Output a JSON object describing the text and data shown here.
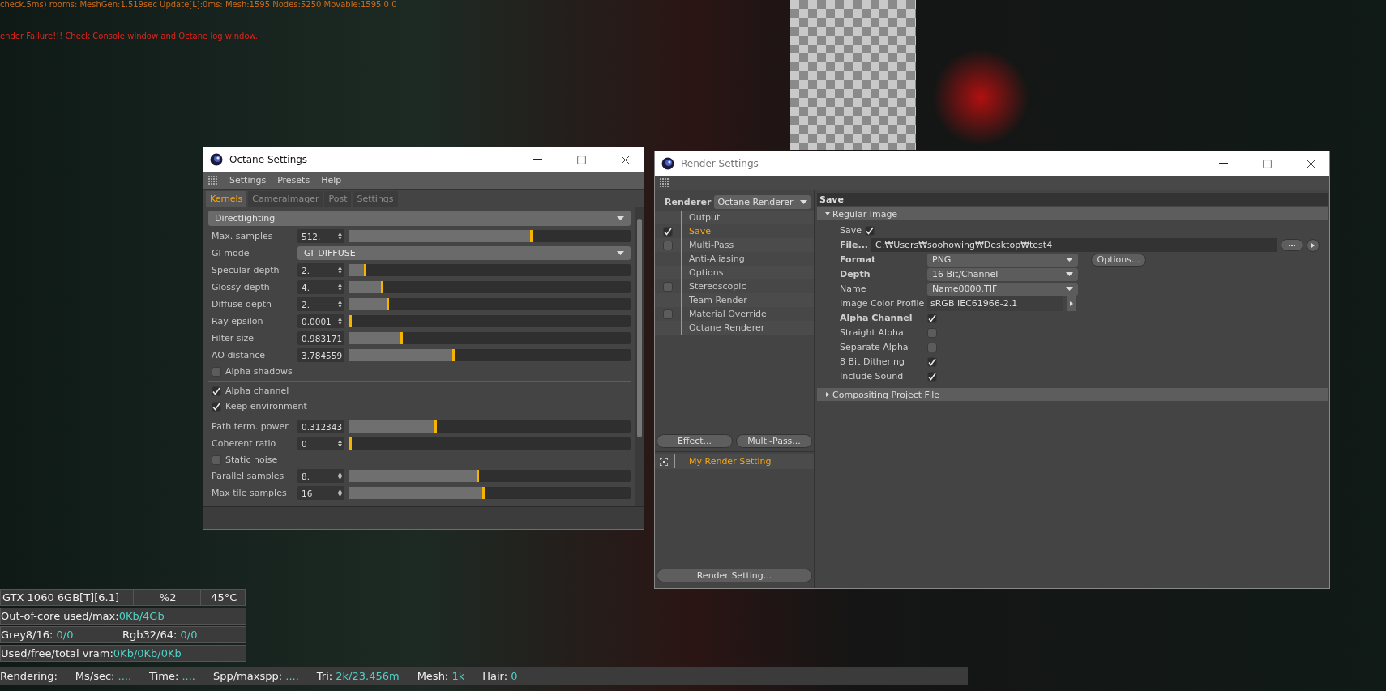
{
  "console_lines": [
    {
      "kind": "info",
      "text": "check.5ms) rooms: MeshGen:1.519sec Update[L]:0ms: Mesh:1595 Nodes:5250 Movable:1595  0 0"
    },
    {
      "kind": "error",
      "text": "ender Failure!!! Check Console window and Octane log window."
    }
  ],
  "octane_settings": {
    "title": "Octane Settings",
    "menu": [
      "Settings",
      "Presets",
      "Help"
    ],
    "tabs": [
      {
        "label": "Kernels",
        "selected": true
      },
      {
        "label": "CameraImager",
        "selected": false
      },
      {
        "label": "Post",
        "selected": false
      },
      {
        "label": "Settings",
        "selected": false
      }
    ],
    "kernel": "Directlighting",
    "rows": [
      {
        "kind": "slider",
        "label": "Max. samples",
        "value": "512.",
        "level": 0.65
      },
      {
        "kind": "dropdown",
        "label": "GI mode",
        "value": "GI_DIFFUSE"
      },
      {
        "kind": "slider",
        "label": "Specular depth",
        "value": "2.",
        "level": 0.06
      },
      {
        "kind": "slider",
        "label": "Glossy depth",
        "value": "4.",
        "level": 0.12
      },
      {
        "kind": "slider",
        "label": "Diffuse depth",
        "value": "2.",
        "level": 0.14
      },
      {
        "kind": "slider",
        "label": "Ray epsilon",
        "value": "0.0001",
        "level": 0
      },
      {
        "kind": "slider",
        "label": "Filter size",
        "value": "0.983171",
        "level": 0.19
      },
      {
        "kind": "slider",
        "label": "AO distance",
        "value": "3.784559",
        "level": 0.375
      },
      {
        "kind": "checkbox",
        "label": "Alpha shadows",
        "checked": false
      },
      {
        "kind": "divider"
      },
      {
        "kind": "checkbox",
        "label": "Alpha channel",
        "checked": true
      },
      {
        "kind": "checkbox",
        "label": "Keep environment",
        "checked": true
      },
      {
        "kind": "divider"
      },
      {
        "kind": "slider",
        "label": "Path term. power",
        "value": "0.312343",
        "level": 0.31
      },
      {
        "kind": "slider",
        "label": "Coherent ratio",
        "value": "0",
        "level": 0
      },
      {
        "kind": "checkbox",
        "label": "Static noise",
        "checked": false
      },
      {
        "kind": "slider",
        "label": "Parallel samples",
        "value": "8.",
        "level": 0.46
      },
      {
        "kind": "slider",
        "label": "Max tile samples",
        "value": "16",
        "level": 0.48
      }
    ]
  },
  "render_settings": {
    "title": "Render Settings",
    "renderer_label": "Renderer",
    "renderer": "Octane Renderer",
    "tree": [
      {
        "kind": "plain",
        "label": "Output",
        "selected": false
      },
      {
        "kind": "toggle",
        "label": "Save",
        "checked": true,
        "selected": true
      },
      {
        "kind": "toggle",
        "label": "Multi-Pass",
        "checked": false,
        "selected": false
      },
      {
        "kind": "plain",
        "label": "Anti-Aliasing",
        "selected": false
      },
      {
        "kind": "plain",
        "label": "Options",
        "selected": false
      },
      {
        "kind": "toggle",
        "label": "Stereoscopic",
        "checked": false,
        "selected": false
      },
      {
        "kind": "plain",
        "label": "Team Render",
        "selected": false
      },
      {
        "kind": "toggle",
        "label": "Material Override",
        "checked": false,
        "selected": false
      },
      {
        "kind": "plain",
        "label": "Octane Renderer",
        "selected": false
      }
    ],
    "buttons": [
      "Effect...",
      "Multi-Pass..."
    ],
    "setting_list": [
      {
        "label": "My Render Setting",
        "selected": true
      }
    ],
    "bottom_button": "Render Setting...",
    "panel_title": "Save",
    "sections": [
      {
        "title": "Regular Image",
        "expanded": true,
        "fields": [
          {
            "kind": "check",
            "label": "Save",
            "checked": true,
            "bold": false
          },
          {
            "kind": "file",
            "label": "File...",
            "value": "C:₩Users₩soohowing₩Desktop₩test4",
            "bold": true
          },
          {
            "kind": "select",
            "label": "Format",
            "value": "PNG",
            "button": "Options...",
            "bold": true
          },
          {
            "kind": "select",
            "label": "Depth",
            "value": "16 Bit/Channel",
            "bold": true
          },
          {
            "kind": "select",
            "label": "Name",
            "value": "Name0000.TIF",
            "bold": false
          },
          {
            "kind": "profile",
            "label": "Image Color Profile",
            "value": "sRGB IEC61966-2.1",
            "bold": false
          },
          {
            "kind": "check",
            "label": "Alpha Channel",
            "checked": true,
            "bold": true
          },
          {
            "kind": "check",
            "label": "Straight Alpha",
            "checked": false,
            "bold": false
          },
          {
            "kind": "check",
            "label": "Separate Alpha",
            "checked": false,
            "bold": false
          },
          {
            "kind": "check",
            "label": "8 Bit Dithering",
            "checked": true,
            "bold": false
          },
          {
            "kind": "check",
            "label": "Include Sound",
            "checked": true,
            "bold": false
          }
        ]
      },
      {
        "title": "Compositing Project File",
        "expanded": false
      }
    ]
  },
  "gpu_stats": {
    "device": [
      "GTX 1060 6GB[T][6.1]",
      "%2",
      "45°C"
    ],
    "rows": [
      [
        {
          "label": "Out-of-core used/max:",
          "value": "0Kb/4Gb"
        }
      ],
      [
        {
          "label": "Grey8/16:",
          "value": "0/0"
        },
        {
          "label": "Rgb32/64:",
          "value": "0/0"
        }
      ],
      [
        {
          "label": "Used/free/total vram:",
          "value": "0Kb/0Kb/0Kb"
        }
      ]
    ]
  },
  "status_bar": [
    {
      "label": "Rendering:"
    },
    {
      "label": "Ms/sec:",
      "value": "...."
    },
    {
      "label": "Time:",
      "value": "...."
    },
    {
      "label": "Spp/maxspp:",
      "value": "...."
    },
    {
      "label": "Tri:",
      "value": "2k/23.456m"
    },
    {
      "label": "Mesh:",
      "value": "1k"
    },
    {
      "label": "Hair:",
      "value": "0"
    }
  ]
}
